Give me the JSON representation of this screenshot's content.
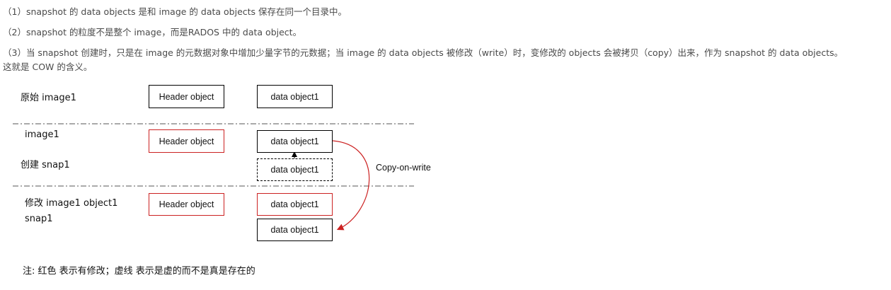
{
  "paragraphs": [
    "（1）snapshot 的 data objects 是和 image 的 data objects 保存在同一个目录中。",
    "（2）snapshot 的粒度不是整个 image，而是RADOS 中的 data object。",
    "（3）当 snapshot 创建时，只是在 image 的元数据对象中增加少量字节的元数据；当 image 的 data objects 被修改（write）时，变修改的 objects 会被拷贝（copy）出来，作为 snapshot 的 data objects。",
    "这就是 COW 的含义。"
  ],
  "diagram": {
    "row1": {
      "label": "原始 image1",
      "header": "Header object",
      "data": "data object1"
    },
    "row2": {
      "label_image": "image1",
      "label_snap": "创建 snap1",
      "header": "Header object",
      "data": "data object1",
      "data_snap": "data object1"
    },
    "row3": {
      "label_modify": "修改 image1 object1",
      "label_snap": "snap1",
      "header": "Header object",
      "data": "data object1",
      "data_snap": "data object1"
    },
    "arrow_label": "Copy-on-write",
    "colors": {
      "modified": "#cc2222",
      "normal": "#000000"
    }
  },
  "note": "注: 红色 表示有修改；虚线 表示是虚的而不是真是存在的"
}
